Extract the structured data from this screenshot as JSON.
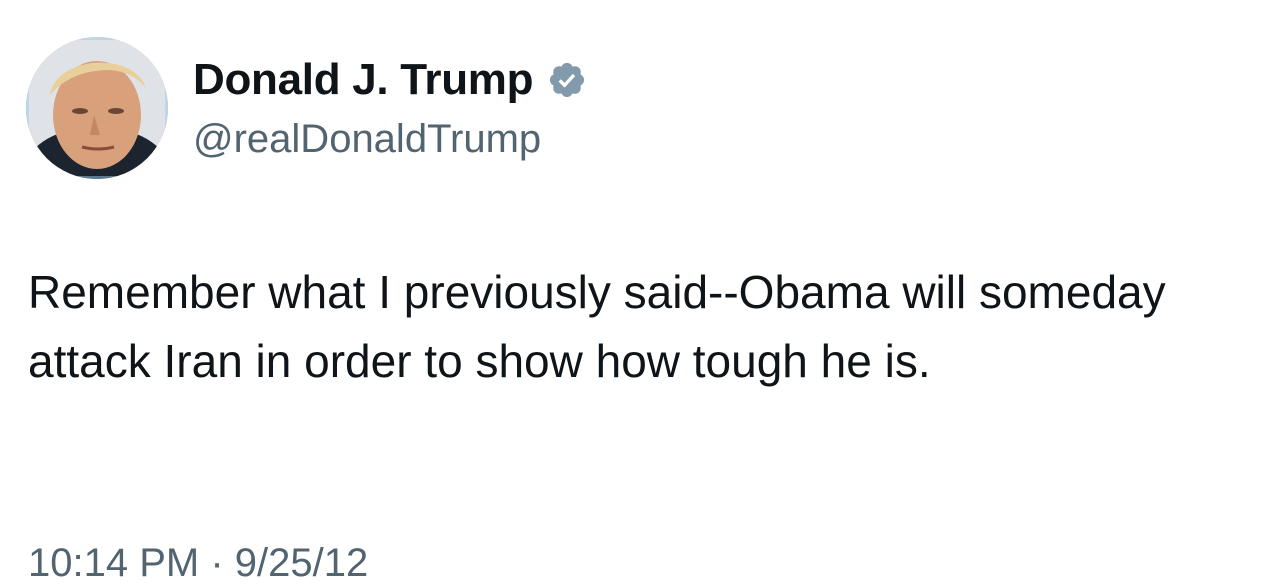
{
  "tweet": {
    "author": {
      "display_name": "Donald J. Trump",
      "handle": "@realDonaldTrump",
      "verified_icon": "verified-badge-icon",
      "avatar": "profile-photo"
    },
    "text": "Remember what I previously said--Obama will someday attack Iran in order to show how tough he is.",
    "timestamp": "10:14 PM · 9/25/12"
  },
  "colors": {
    "text": "#0f1419",
    "secondary": "#536471",
    "badge": "#829aab",
    "background": "#ffffff"
  }
}
